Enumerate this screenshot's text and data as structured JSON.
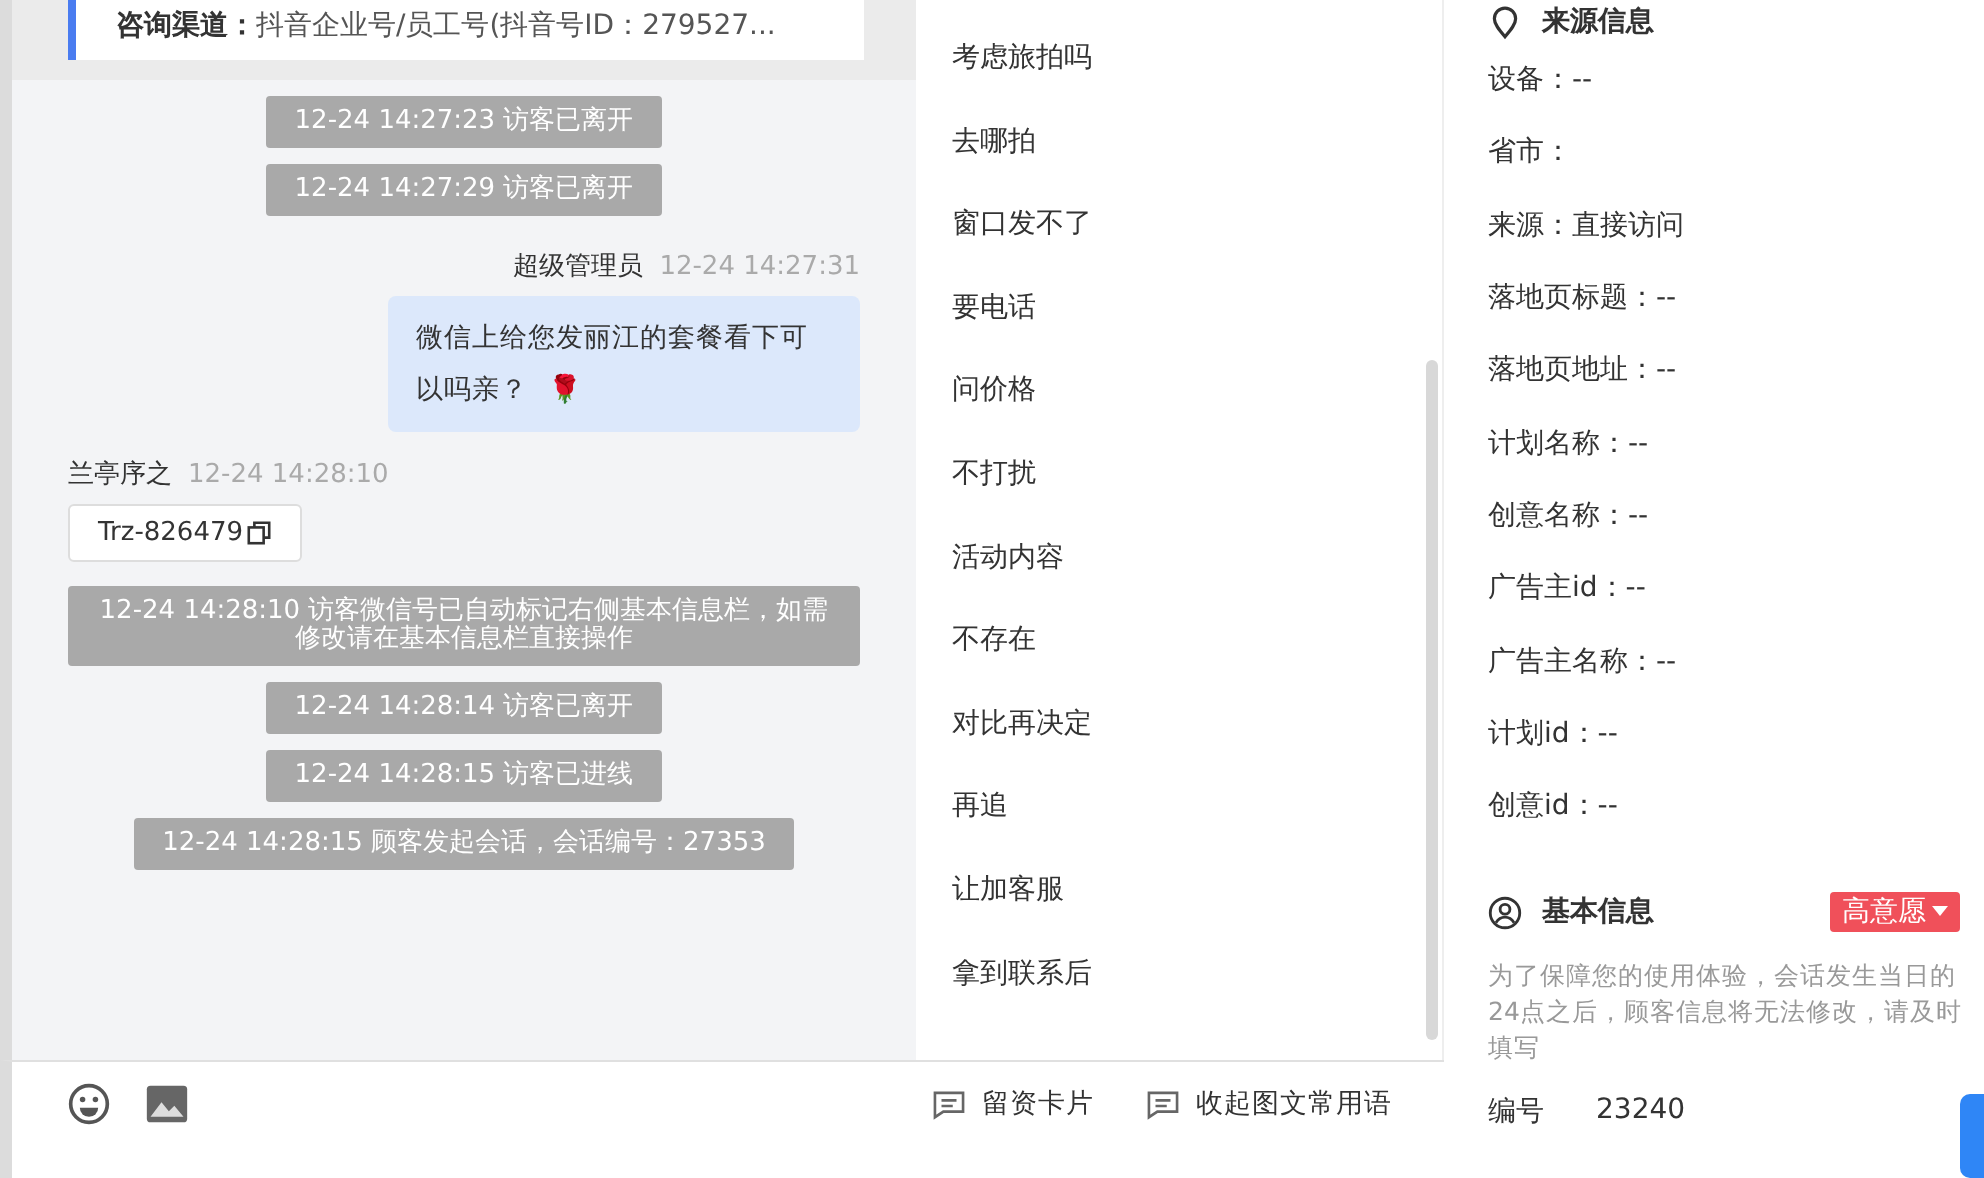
{
  "channel_card": {
    "label": "咨询渠道：",
    "value": "抖音企业号/员工号(抖音号ID：279527..."
  },
  "messages": [
    {
      "kind": "event",
      "text": "12-24 14:27:23 访客已离开"
    },
    {
      "kind": "event",
      "text": "12-24 14:27:29 访客已离开"
    },
    {
      "kind": "outgoing",
      "sender": "超级管理员",
      "time": "12-24 14:27:31",
      "text": "微信上给您发丽江的套餐看下可以吗亲？",
      "emoji": "🌹"
    },
    {
      "kind": "incoming",
      "sender": "兰亭序之",
      "time": "12-24 14:28:10",
      "text": "Trz-826479"
    },
    {
      "kind": "event",
      "text": "12-24 14:28:10 访客微信号已自动标记右侧基本信息栏，如需修改请在基本信息栏直接操作"
    },
    {
      "kind": "event",
      "text": "12-24 14:28:14 访客已离开"
    },
    {
      "kind": "event",
      "text": "12-24 14:28:15 访客已进线"
    },
    {
      "kind": "event",
      "text": "12-24 14:28:15 顾客发起会话，会话编号：27353"
    }
  ],
  "phrases": [
    "考虑旅拍吗",
    "去哪拍",
    "窗口发不了",
    "要电话",
    "问价格",
    "不打扰",
    "活动内容",
    "不存在",
    "对比再决定",
    "再追",
    "让加客服",
    "拿到联系后"
  ],
  "toolbar": {
    "actions": [
      "留资卡片",
      "收起图文常用语"
    ]
  },
  "source_info": {
    "title": "来源信息",
    "fields": [
      "设备：--",
      "省市：",
      "来源：直接访问",
      "落地页标题：--",
      "落地页地址：--",
      "计划名称：--",
      "创意名称：--",
      "广告主id：--",
      "广告主名称：--",
      "计划id：--",
      "创意id：--"
    ]
  },
  "basic_info": {
    "title": "基本信息",
    "intent_tag": "高意愿",
    "notice": "为了保障您的使用体验，会话发生当日的24点之后，顾客信息将无法修改，请及时填写",
    "fields": [
      {
        "label": "编号",
        "value": "23240"
      }
    ]
  }
}
